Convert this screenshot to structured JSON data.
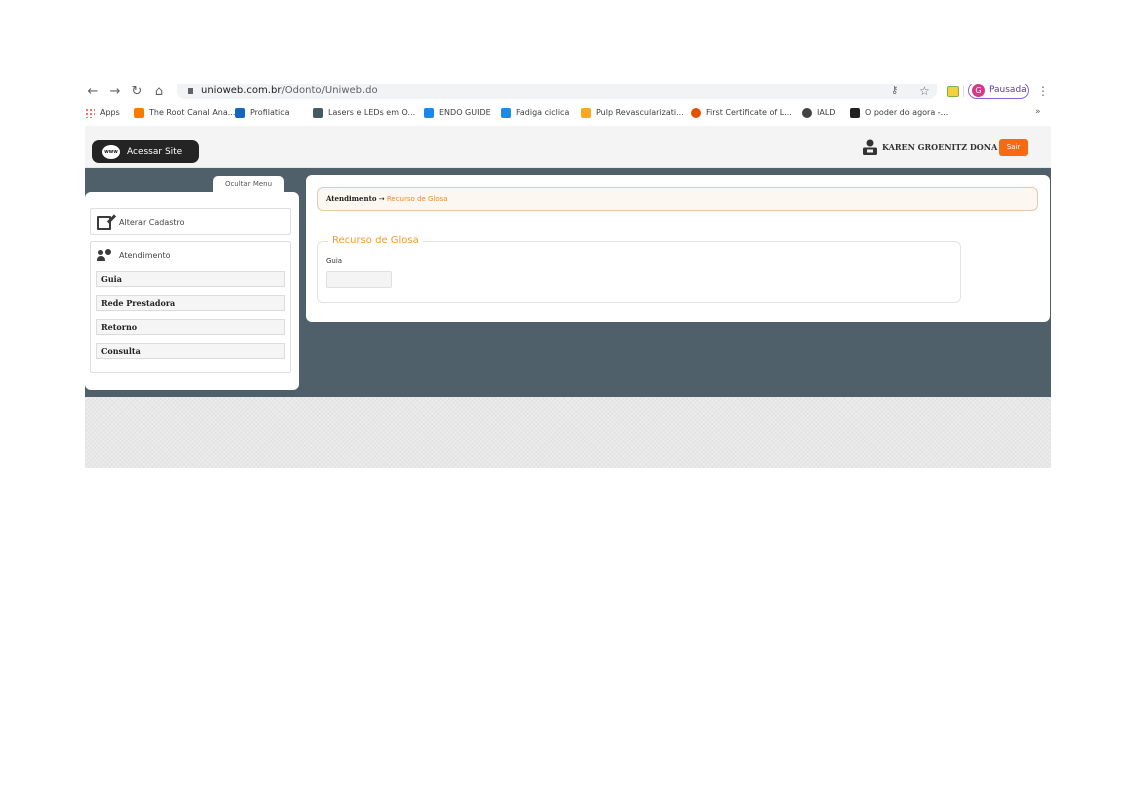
{
  "browser": {
    "url_host": "unioweb.com.br",
    "url_path": "/Odonto/Uniweb.do",
    "profile_initial": "G",
    "profile_status": "Pausada"
  },
  "bookmarks": [
    {
      "label": "Apps",
      "color": "#ea4335"
    },
    {
      "label": "The Root Canal Ana...",
      "color": "#f57c00"
    },
    {
      "label": "Profilatica",
      "color": "#1565c0"
    },
    {
      "label": "Lasers e LEDs em O...",
      "color": "#455a64"
    },
    {
      "label": "ENDO GUIDE",
      "color": "#1e88e5"
    },
    {
      "label": "Fadiga ciclica",
      "color": "#1e88e5"
    },
    {
      "label": "Pulp Revascularizati...",
      "color": "#f9a825"
    },
    {
      "label": "First Certificate of L...",
      "color": "#e65100"
    },
    {
      "label": "IALD",
      "color": "#424242"
    },
    {
      "label": "O poder do agora -...",
      "color": "#212121"
    }
  ],
  "header": {
    "site_button": "Acessar Site",
    "www_label": "www",
    "user_name": "KAREN GROENITZ DONA",
    "logout": "Sair"
  },
  "sidebar": {
    "hide_menu": "Ocultar Menu",
    "edit_profile": "Alterar Cadastro",
    "section": "Atendimento",
    "items": [
      "Guia",
      "Rede Prestadora",
      "Retorno",
      "Consulta"
    ]
  },
  "main": {
    "breadcrumb_root": "Atendimento",
    "breadcrumb_arrow": "→",
    "breadcrumb_current": "Recurso de Glosa",
    "form_title": "Recurso de Glosa",
    "field_label": "Guia",
    "field_value": ""
  }
}
